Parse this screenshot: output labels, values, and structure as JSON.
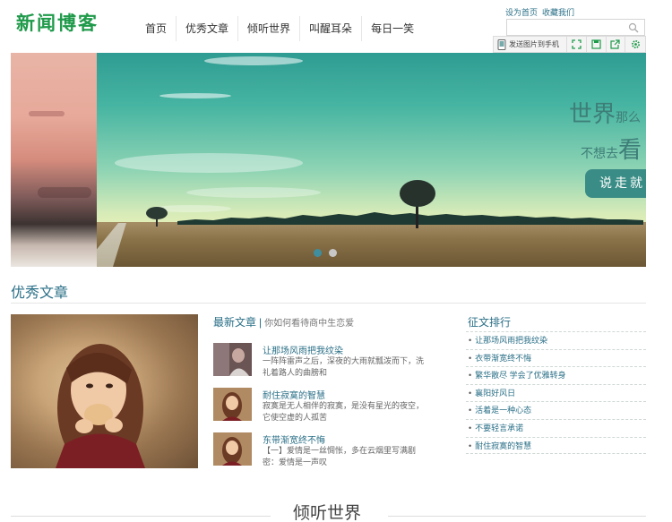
{
  "header": {
    "logo": "新闻博客",
    "nav": [
      "首页",
      "优秀文章",
      "倾听世界",
      "叫醒耳朵",
      "每日一笑"
    ],
    "top_links": [
      "设为首页",
      "收藏我们"
    ],
    "search_placeholder": "",
    "toolbar": {
      "send_label": "发送图片到手机",
      "icons": [
        "fullscreen-icon",
        "save-icon",
        "share-icon",
        "settings-icon"
      ]
    }
  },
  "banner": {
    "line1_big": "世界",
    "line1_small": "那么",
    "line2_small": "不想去",
    "line2_big": "看",
    "button": "说走就",
    "dots": 2,
    "active_dot": 1
  },
  "excellent": {
    "title": "优秀文章",
    "latest_title": "最新文章",
    "latest_subtitle": "你如何看待商中生恋爱",
    "articles": [
      {
        "title": "让那场风雨把我纹染",
        "desc": "一阵阵雷声之后，深夜的大雨就瓢泼而下，洗礼着路人的曲膀和"
      },
      {
        "title": "耐住寂寞的智慧",
        "desc": "寂寞是无人相伴的寂寞，是没有星光的夜空，它使空虚的人孤苦"
      },
      {
        "title": "东带渐宽终不悔",
        "desc": "【一】爱情是一丝惆怅，多在云烟里写满剧密：爱情是一声叹"
      }
    ],
    "rank_title": "征文排行",
    "rank_items": [
      "让那场风雨把我纹染",
      "衣带渐宽终不悔",
      "繁华散尽 学会了优雅转身",
      "襄阳好风日",
      "活着是一种心态",
      "不要轻言承诺",
      "耐住寂寞的智慧"
    ]
  },
  "listening": {
    "title": "倾听世界"
  }
}
